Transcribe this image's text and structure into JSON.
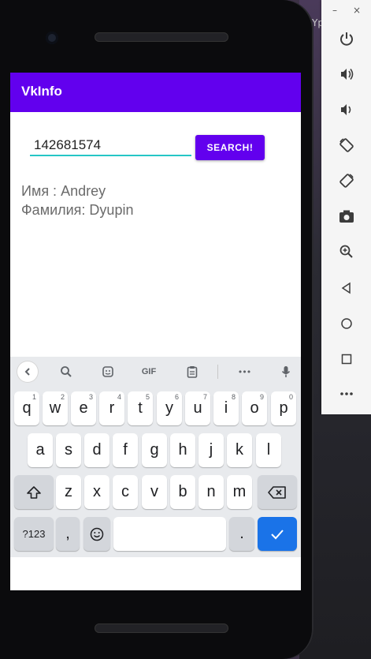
{
  "app": {
    "title": "VkInfo"
  },
  "search": {
    "value": "142681574",
    "button_label": "SEARCH!"
  },
  "results": {
    "first_name": "Имя : Andrey",
    "last_name": "Фамилия: Dyupin"
  },
  "desktop": {
    "partial_text": "Yp"
  },
  "emulator": {
    "window_controls": [
      "–",
      "×"
    ]
  },
  "keyboard": {
    "row1": [
      {
        "key": "q",
        "hint": "1"
      },
      {
        "key": "w",
        "hint": "2"
      },
      {
        "key": "e",
        "hint": "3"
      },
      {
        "key": "r",
        "hint": "4"
      },
      {
        "key": "t",
        "hint": "5"
      },
      {
        "key": "y",
        "hint": "6"
      },
      {
        "key": "u",
        "hint": "7"
      },
      {
        "key": "i",
        "hint": "8"
      },
      {
        "key": "o",
        "hint": "9"
      },
      {
        "key": "p",
        "hint": "0"
      }
    ],
    "row2": [
      "a",
      "s",
      "d",
      "f",
      "g",
      "h",
      "j",
      "k",
      "l"
    ],
    "row3": [
      "z",
      "x",
      "c",
      "v",
      "b",
      "n",
      "m"
    ],
    "bottom": {
      "symbols": "?123",
      "comma": ",",
      "period": "."
    },
    "suggestion_icons": [
      "back-icon",
      "search-icon",
      "sticker-icon",
      "gif-icon",
      "clipboard-icon",
      "more-icon",
      "mic-icon"
    ],
    "gif_label": "GIF",
    "more_label": "•••"
  },
  "sidebar_icons": [
    "power-icon",
    "volume-up-icon",
    "volume-down-icon",
    "rotate-left-icon",
    "rotate-right-icon",
    "camera-icon",
    "zoom-icon",
    "back-icon",
    "home-icon",
    "overview-icon",
    "more-icon"
  ],
  "colors": {
    "primary": "#6200ee",
    "accent": "#26c6c6",
    "enter": "#1a73e8"
  }
}
